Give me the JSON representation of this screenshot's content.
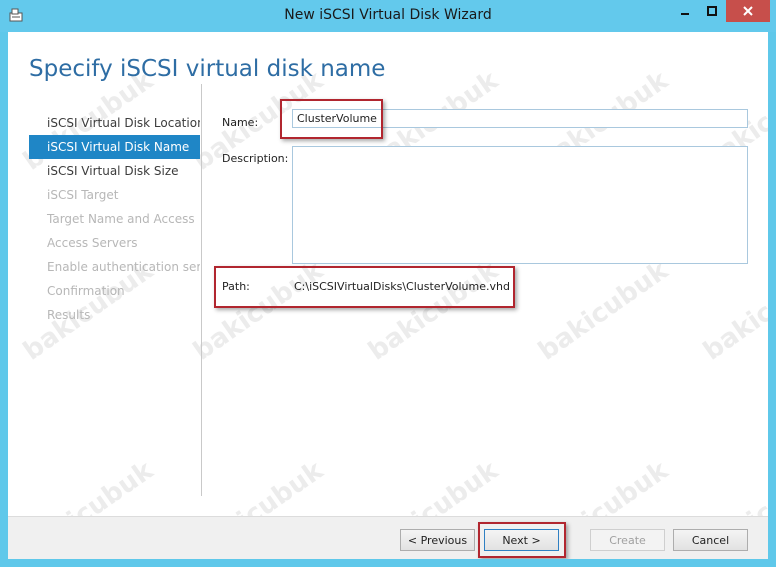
{
  "window": {
    "title": "New iSCSI Virtual Disk Wizard",
    "icon": "wizard-app-icon"
  },
  "page": {
    "heading": "Specify iSCSI virtual disk name"
  },
  "nav": {
    "items": [
      {
        "label": "iSCSI Virtual Disk Location",
        "state": "normal"
      },
      {
        "label": "iSCSI Virtual Disk Name",
        "state": "selected"
      },
      {
        "label": "iSCSI Virtual Disk Size",
        "state": "normal"
      },
      {
        "label": "iSCSI Target",
        "state": "disabled"
      },
      {
        "label": "Target Name and Access",
        "state": "disabled"
      },
      {
        "label": "Access Servers",
        "state": "disabled"
      },
      {
        "label": "Enable authentication ser...",
        "state": "disabled"
      },
      {
        "label": "Confirmation",
        "state": "disabled"
      },
      {
        "label": "Results",
        "state": "disabled"
      }
    ]
  },
  "form": {
    "name_label": "Name:",
    "name_value": "ClusterVolume",
    "description_label": "Description:",
    "description_value": "",
    "path_label": "Path:",
    "path_value": "C:\\iSCSIVirtualDisks\\ClusterVolume.vhd"
  },
  "buttons": {
    "previous": "< Previous",
    "next": "Next >",
    "create": "Create",
    "cancel": "Cancel"
  },
  "watermark": "bakicubuk",
  "colors": {
    "heading": "#2e6da4",
    "nav_selected": "#1f86c6",
    "highlight": "#b1262f",
    "titlebar": "#63c9ec",
    "close": "#c74f4b"
  }
}
